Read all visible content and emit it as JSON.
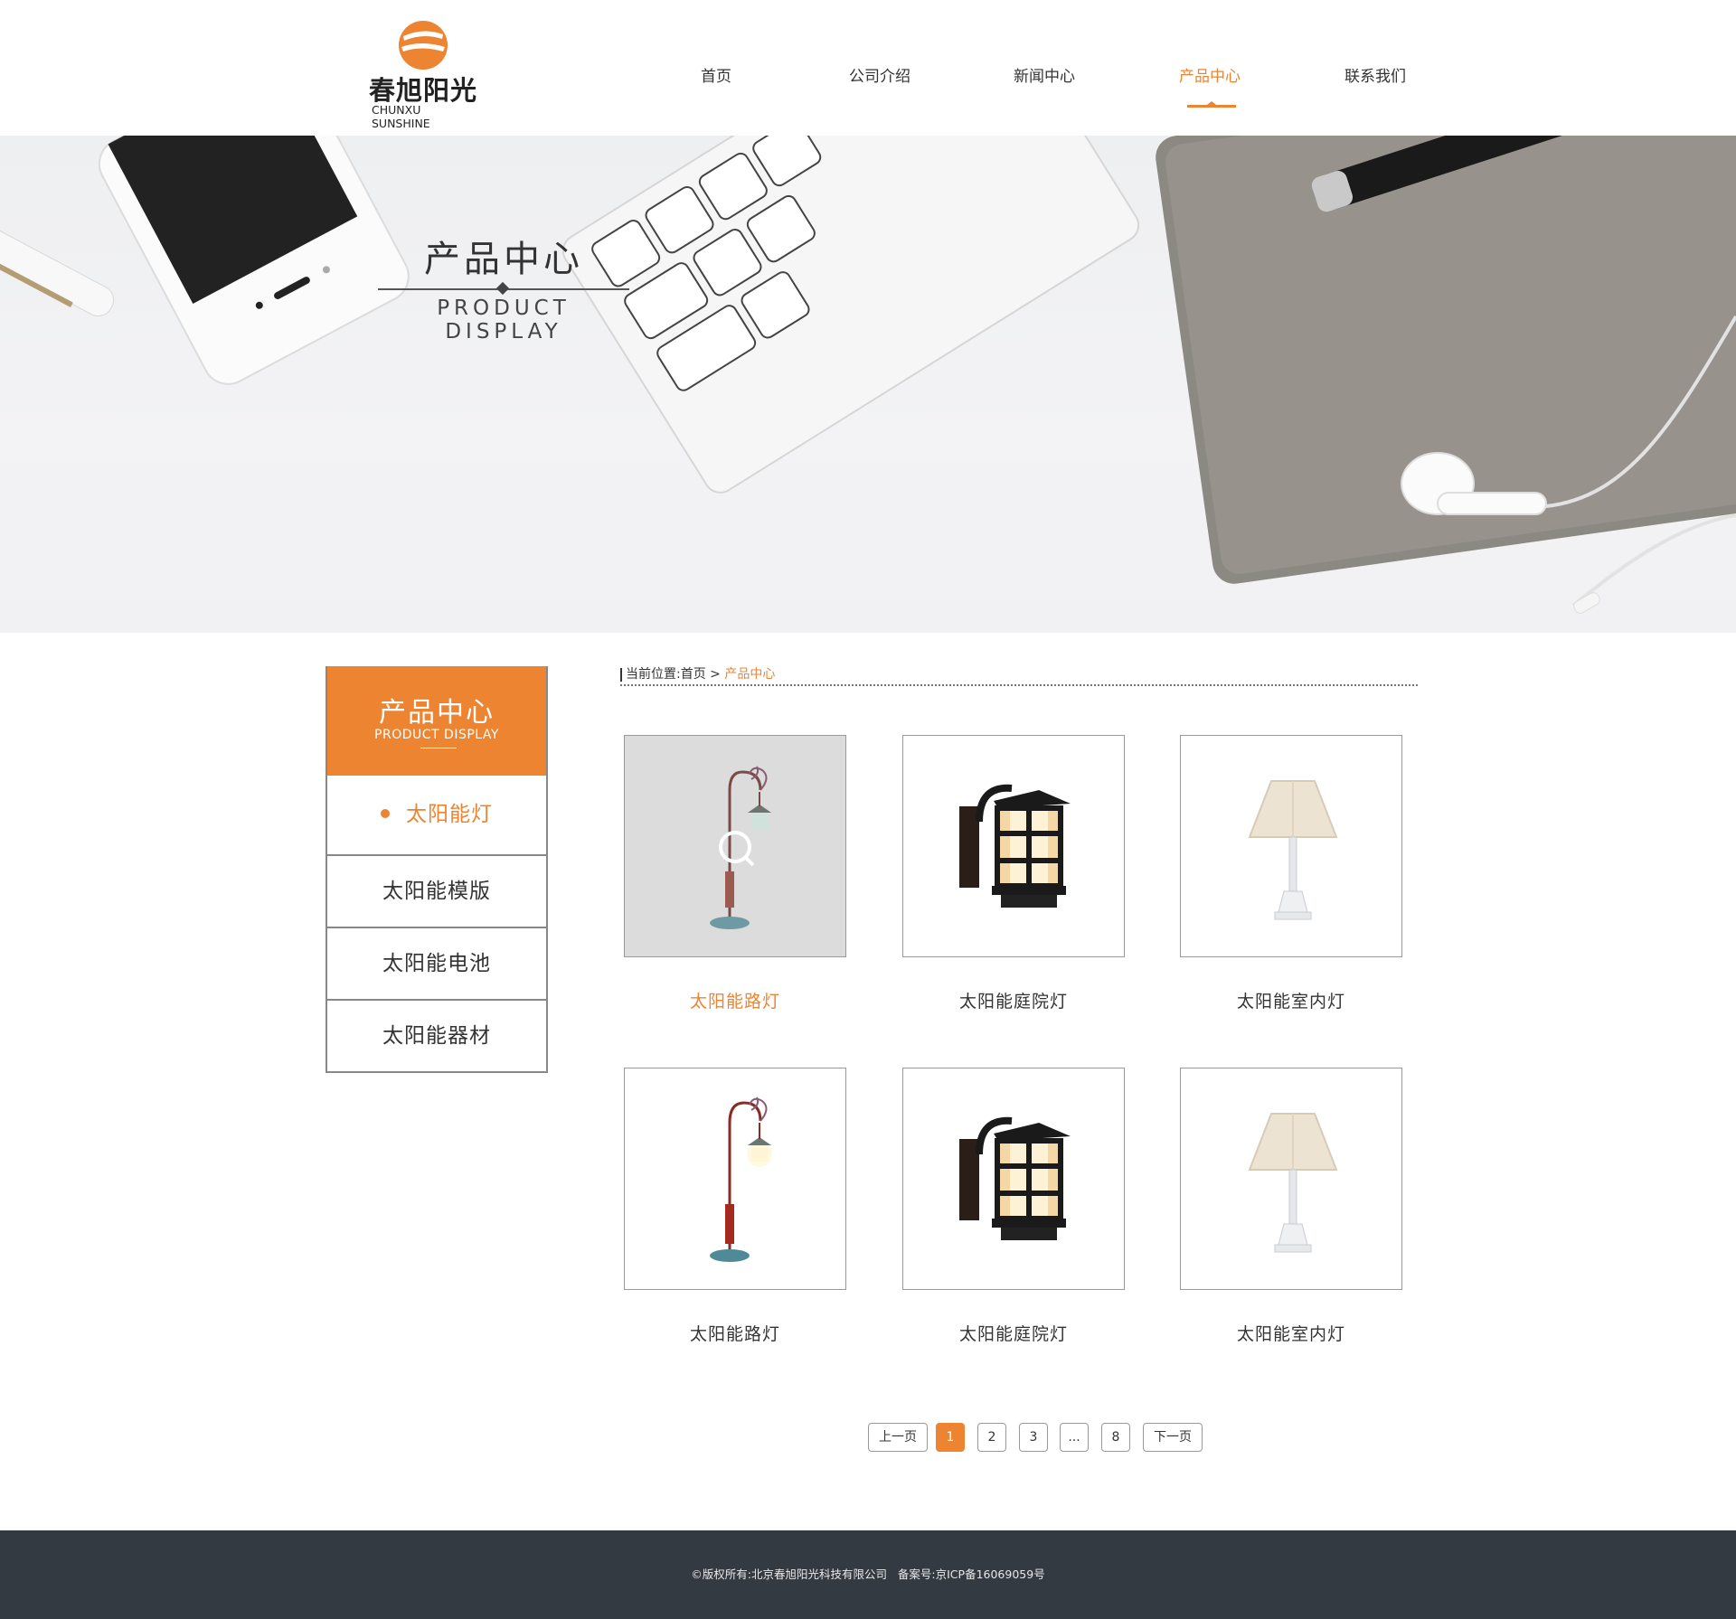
{
  "brand": {
    "name_cn": "春旭阳光",
    "name_en": "CHUNXU SUNSHINE",
    "accent_color": "#ec8431"
  },
  "nav": {
    "items": [
      {
        "label": "首页"
      },
      {
        "label": "公司介绍"
      },
      {
        "label": "新闻中心"
      },
      {
        "label": "产品中心"
      },
      {
        "label": "联系我们"
      }
    ],
    "active_index": 3
  },
  "banner": {
    "title_cn": "产品中心",
    "title_en": "PRODUCT DISPLAY"
  },
  "sidebar": {
    "title_cn": "产品中心",
    "title_en": "PRODUCT DISPLAY",
    "items": [
      {
        "label": "太阳能灯",
        "active": true
      },
      {
        "label": "太阳能模版",
        "active": false
      },
      {
        "label": "太阳能电池",
        "active": false
      },
      {
        "label": "太阳能器材",
        "active": false
      }
    ]
  },
  "breadcrumb": {
    "prefix": "当前位置:",
    "home": "首页",
    "separator": ">",
    "current": "产品中心"
  },
  "products": [
    {
      "title": "太阳能路灯",
      "icon": "street-lamp-icon",
      "highlighted": true
    },
    {
      "title": "太阳能庭院灯",
      "icon": "wall-lantern-icon",
      "highlighted": false
    },
    {
      "title": "太阳能室内灯",
      "icon": "table-lamp-icon",
      "highlighted": false
    },
    {
      "title": "太阳能路灯",
      "icon": "street-lamp-icon",
      "highlighted": false
    },
    {
      "title": "太阳能庭院灯",
      "icon": "wall-lantern-icon",
      "highlighted": false
    },
    {
      "title": "太阳能室内灯",
      "icon": "table-lamp-icon",
      "highlighted": false
    }
  ],
  "pagination": {
    "prev": "上一页",
    "pages": [
      "1",
      "2",
      "3",
      "...",
      "8"
    ],
    "current": "1",
    "next": "下一页"
  },
  "footer": {
    "text": "©版权所有:北京春旭阳光科技有限公司   备案号:京ICP备16069059号"
  }
}
